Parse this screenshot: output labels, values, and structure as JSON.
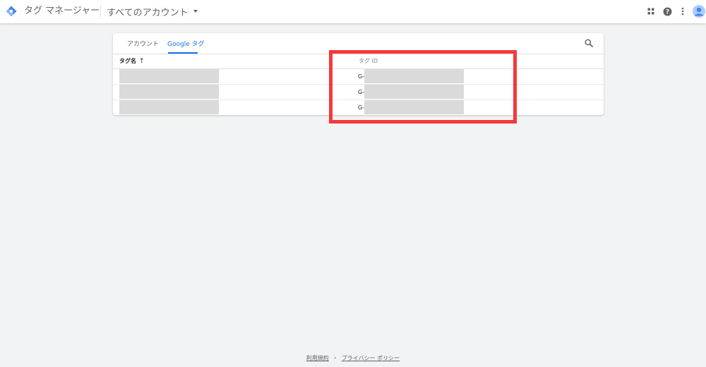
{
  "header": {
    "app_title": "タグ マネージャー",
    "account_selector": "すべてのアカウント"
  },
  "tabs": [
    {
      "label": "アカウント",
      "active": false
    },
    {
      "label": "Google タグ",
      "active": true
    }
  ],
  "table": {
    "columns": [
      "タグ名",
      "タグ ID"
    ],
    "sort_indicator": "↑",
    "rows": [
      {
        "name": "",
        "id_prefix": "G-",
        "id": ""
      },
      {
        "name": "",
        "id_prefix": "G-",
        "id": ""
      },
      {
        "name": "",
        "id_prefix": "G-",
        "id": ""
      }
    ]
  },
  "footer": {
    "terms": "利用規約",
    "separator": "・",
    "privacy": "プライバシー ポリシー"
  },
  "colors": {
    "accent": "#1a73e8",
    "highlight": "#f4393c",
    "redaction": "#dadada",
    "background": "#f1f3f4"
  },
  "icons": [
    "tag-manager-logo-icon",
    "chevron-down-icon",
    "apps-grid-icon",
    "help-icon",
    "more-vert-icon",
    "account-avatar-icon",
    "search-icon",
    "arrow-up-icon"
  ]
}
